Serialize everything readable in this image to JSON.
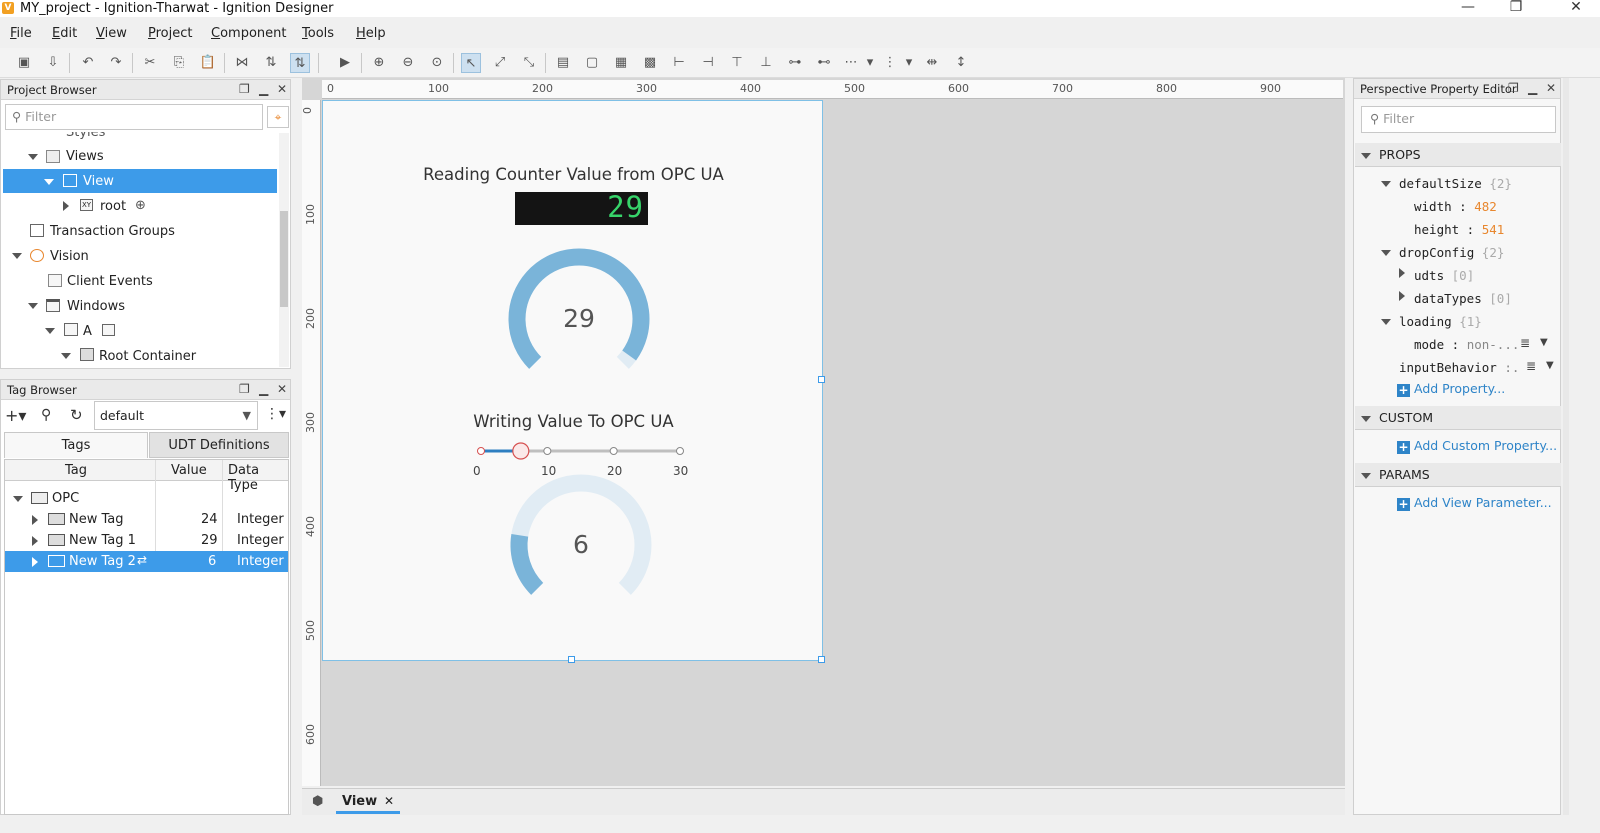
{
  "window": {
    "title": "MY_project - Ignition-Tharwat - Ignition Designer",
    "logo": "V",
    "minimize": "—",
    "restore": "❐",
    "close": "✕"
  },
  "menu": {
    "items": [
      {
        "u": "F",
        "rest": "ile"
      },
      {
        "u": "E",
        "rest": "dit"
      },
      {
        "u": "V",
        "rest": "iew"
      },
      {
        "u": "P",
        "rest": "roject"
      },
      {
        "u": "C",
        "rest": "omponent"
      },
      {
        "u": "T",
        "rest": "ools"
      },
      {
        "u": "H",
        "rest": "elp"
      }
    ]
  },
  "project_browser": {
    "title": "Project Browser",
    "filter_placeholder": "Filter",
    "items": {
      "styles": "Styles",
      "views": "Views",
      "view": "View",
      "root": "root",
      "transaction_groups": "Transaction Groups",
      "vision": "Vision",
      "client_events": "Client Events",
      "windows": "Windows",
      "window_a": "A",
      "root_container": "Root Container"
    }
  },
  "tag_browser": {
    "title": "Tag Browser",
    "provider": "default",
    "tabs": {
      "tags": "Tags",
      "udt": "UDT Definitions"
    },
    "columns": {
      "tag": "Tag",
      "value": "Value",
      "type": "Data Type"
    },
    "folder": "OPC",
    "rows": [
      {
        "name": "New Tag",
        "value": "24",
        "type": "Integer"
      },
      {
        "name": "New Tag 1",
        "value": "29",
        "type": "Integer"
      },
      {
        "name": "New Tag 2",
        "value": "6",
        "type": "Integer"
      }
    ]
  },
  "rulers": {
    "h": [
      "0",
      "100",
      "200",
      "300",
      "400",
      "500",
      "600",
      "700",
      "800",
      "900"
    ],
    "v": [
      "0",
      "100",
      "200",
      "300",
      "400",
      "500",
      "600"
    ]
  },
  "view": {
    "reading_title": "Reading Counter Value from OPC UA",
    "led_value": "29",
    "gauge1": {
      "value": 29,
      "label": "29",
      "max": 30
    },
    "writing_title": "Writing Value To OPC UA",
    "slider": {
      "min": 0,
      "max": 30,
      "value": 6,
      "ticks": [
        "0",
        "10",
        "20",
        "30"
      ]
    },
    "gauge2": {
      "value": 6,
      "label": "6",
      "max": 30
    },
    "colors": {
      "gauge": "#7ab4d9",
      "gauge_track": "#e1ecf4",
      "led": "#37d46a",
      "selection": "#3d9be9"
    }
  },
  "bottom_tab": {
    "label": "View",
    "close": "✕"
  },
  "property_editor": {
    "title": "Perspective Property Editor",
    "filter_placeholder": "Filter",
    "sections": {
      "props": "PROPS",
      "custom": "CUSTOM",
      "params": "PARAMS"
    },
    "props": {
      "defaultSize": {
        "key": "defaultSize",
        "count": "{2}"
      },
      "width": {
        "key": "width",
        "val": "482"
      },
      "height": {
        "key": "height",
        "val": "541"
      },
      "dropConfig": {
        "key": "dropConfig",
        "count": "{2}"
      },
      "udts": {
        "key": "udts",
        "count": "[0]"
      },
      "dataTypes": {
        "key": "dataTypes",
        "count": "[0]"
      },
      "loading": {
        "key": "loading",
        "count": "{1}"
      },
      "mode": {
        "key": "mode",
        "val": "non-..."
      },
      "inputBehavior": {
        "key": "inputBehavior",
        "val": ":."
      }
    },
    "add_property": "Add Property...",
    "add_custom": "Add Custom Property...",
    "add_param": "Add View Parameter..."
  }
}
